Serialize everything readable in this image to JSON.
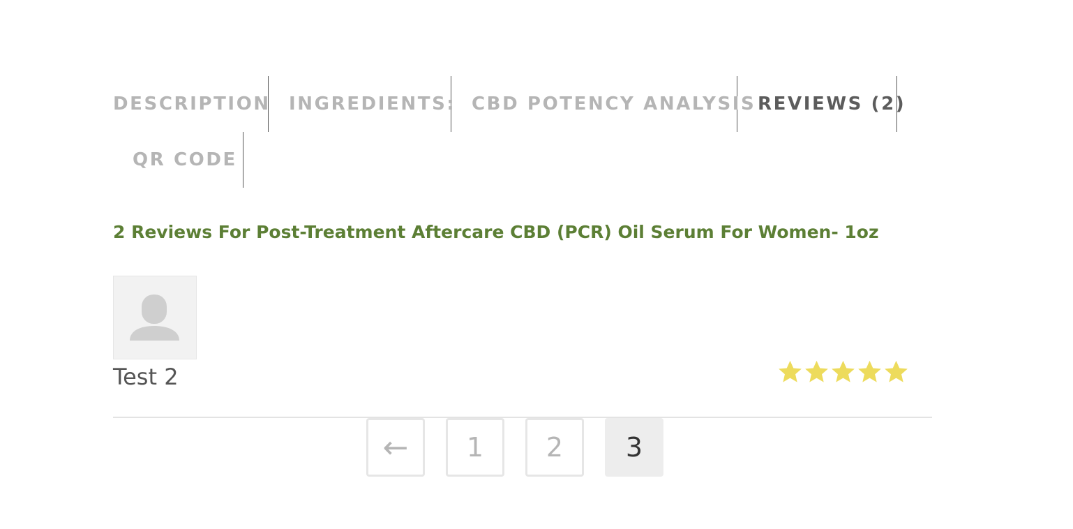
{
  "tabs": {
    "items": [
      {
        "label": "DESCRIPTION",
        "active": false
      },
      {
        "label": "INGREDIENTS:",
        "active": false
      },
      {
        "label": "CBD POTENCY ANALYSIS",
        "active": false
      },
      {
        "label": "REVIEWS (2)",
        "active": true
      },
      {
        "label": "QR CODE",
        "active": false
      }
    ]
  },
  "reviews": {
    "title": "2 Reviews For Post-Treatment Aftercare CBD (PCR) Oil Serum For Women- 1oz",
    "items": [
      {
        "author": "Test 2",
        "rating": 5,
        "max_rating": 5,
        "avatar_icon": "user-silhouette-icon"
      }
    ]
  },
  "pagination": {
    "prev_label": "←",
    "pages": [
      "1",
      "2",
      "3"
    ],
    "current_page": "3"
  },
  "colors": {
    "title_green": "#5c7f35",
    "star_yellow": "#eddb5c",
    "tab_inactive": "#b5b5b5",
    "tab_active": "#5c5c5c"
  }
}
